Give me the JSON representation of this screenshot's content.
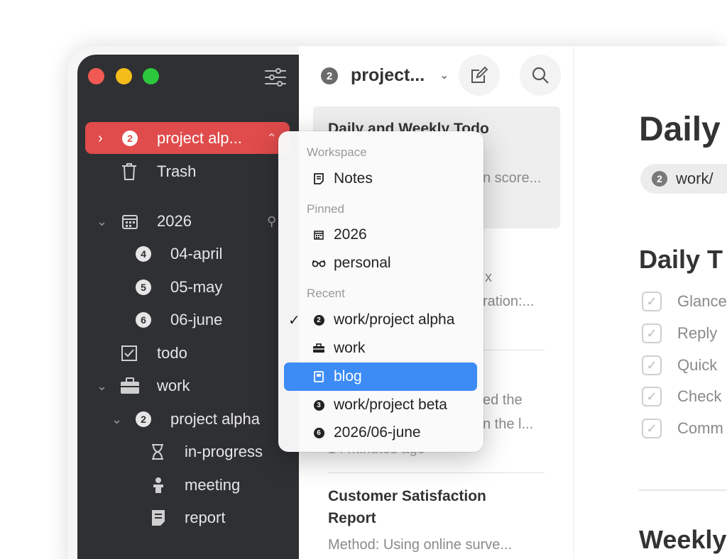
{
  "sidebar": {
    "selected_workspace": {
      "badge": "2",
      "label": "project alp..."
    },
    "trash_label": "Trash",
    "items": [
      {
        "label": "2026",
        "icon": "calendar-icon"
      },
      {
        "label": "04-april",
        "badge": "4"
      },
      {
        "label": "05-may",
        "badge": "5"
      },
      {
        "label": "06-june",
        "badge": "6"
      },
      {
        "label": "todo",
        "icon": "checkbox-icon"
      },
      {
        "label": "work",
        "icon": "briefcase-icon"
      },
      {
        "label": "project alpha",
        "badge": "2"
      },
      {
        "label": "in-progress",
        "icon": "hourglass-icon"
      },
      {
        "label": "meeting",
        "icon": "presenter-icon"
      },
      {
        "label": "report",
        "icon": "document-icon"
      }
    ]
  },
  "list": {
    "header_badge": "2",
    "header_title": "project...",
    "notes": [
      {
        "title": "Daily and Weekly Todo",
        "snippet": "n score..."
      },
      {
        "snippet1": "x",
        "snippet2": "ration:..."
      },
      {
        "snippet1": "ed the",
        "snippet2": "n the l...",
        "time": "14 minutes ago"
      },
      {
        "title1": "Customer Satisfaction",
        "title2": "Report",
        "snippet": "Method: Using online surve..."
      }
    ]
  },
  "editor": {
    "title": "Daily",
    "tag_badge": "2",
    "tag_label": "work/",
    "section": "Daily T",
    "todos": [
      "Glance",
      "Reply",
      "Quick",
      "Check",
      "Comm"
    ],
    "section2": "Weekly"
  },
  "popover": {
    "sections": {
      "workspace": "Workspace",
      "pinned": "Pinned",
      "recent": "Recent"
    },
    "workspace_items": [
      {
        "label": "Notes",
        "icon": "note-icon"
      }
    ],
    "pinned_items": [
      {
        "label": "2026",
        "icon": "calendar-icon"
      },
      {
        "label": "personal",
        "icon": "glasses-icon"
      }
    ],
    "recent_items": [
      {
        "label": "work/project alpha",
        "badge": "2",
        "checked": true
      },
      {
        "label": "work",
        "icon": "briefcase-icon"
      },
      {
        "label": "blog",
        "icon": "book-icon",
        "highlighted": true
      },
      {
        "label": "work/project beta",
        "badge": "3"
      },
      {
        "label": "2026/06-june",
        "badge": "6"
      }
    ]
  },
  "colors": {
    "sidebar_bg": "#2e3033",
    "selected_red": "#e04b4b",
    "highlight_blue": "#3d8cf5"
  }
}
